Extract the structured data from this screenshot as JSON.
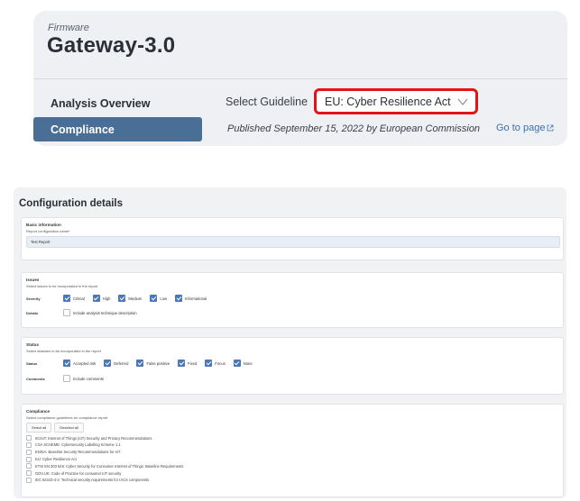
{
  "header": {
    "firmware_label": "Firmware",
    "device_name": "Gateway-3.0"
  },
  "nav": {
    "items": [
      {
        "label": "Analysis Overview",
        "active": false
      },
      {
        "label": "Compliance",
        "active": true
      }
    ]
  },
  "guideline": {
    "label": "Select Guideline",
    "selected": "EU: Cyber Resilience Act",
    "published": "Published September 15, 2022 by European Commission",
    "goto_link": "Go to page",
    "highlight_color": "#e3121b"
  },
  "config": {
    "title": "Configuration details",
    "basic": {
      "title": "Basic information",
      "subtitle": "Report configuration name*",
      "value": "Test Report"
    },
    "issues": {
      "title": "Issues",
      "subtitle": "Select issues to be incorporated in the report",
      "severity_label": "Severity",
      "severities": [
        {
          "label": "Critical",
          "checked": true
        },
        {
          "label": "High",
          "checked": true
        },
        {
          "label": "Medium",
          "checked": true
        },
        {
          "label": "Low",
          "checked": true
        },
        {
          "label": "Informational",
          "checked": true
        }
      ],
      "details_label": "Details",
      "details_option": {
        "label": "Include analysis technique description",
        "checked": false
      }
    },
    "status": {
      "title": "Status",
      "subtitle": "Select statuses to be incorporated in the report",
      "status_label": "Status",
      "statuses": [
        {
          "label": "Accepted risk",
          "checked": true
        },
        {
          "label": "Deferred",
          "checked": true
        },
        {
          "label": "False positive",
          "checked": true
        },
        {
          "label": "Fixed",
          "checked": true
        },
        {
          "label": "Focus",
          "checked": true
        },
        {
          "label": "None",
          "checked": true
        }
      ],
      "comments_label": "Comments",
      "comments_option": {
        "label": "Include comments",
        "checked": false
      }
    },
    "compliance": {
      "title": "Compliance",
      "subtitle": "Select compliance guidelines for compliance report",
      "select_all": "Select all",
      "deselect_all": "Deselect all",
      "guidelines": [
        "IIC/IoT: Internet of Things (IoT) Security and Privacy Recommendations",
        "CSA SCHEME: Cybersecurity Labelling Scheme 1.1",
        "ENISA: Baseline Security Recommendations for IoT",
        "EU: Cyber Resilience Act",
        "ETSI EN 303 645: Cyber Security for Consumer Internet of Things: Baseline Requirements",
        "GOV.UK: Code of Practice for consumer IoT security",
        "IEC 62443-4-2: Technical security requirements for IACS components"
      ]
    }
  },
  "colors": {
    "accent_nav": "#4a6f96",
    "checkbox": "#4a78b8",
    "link": "#3a6fb0"
  }
}
